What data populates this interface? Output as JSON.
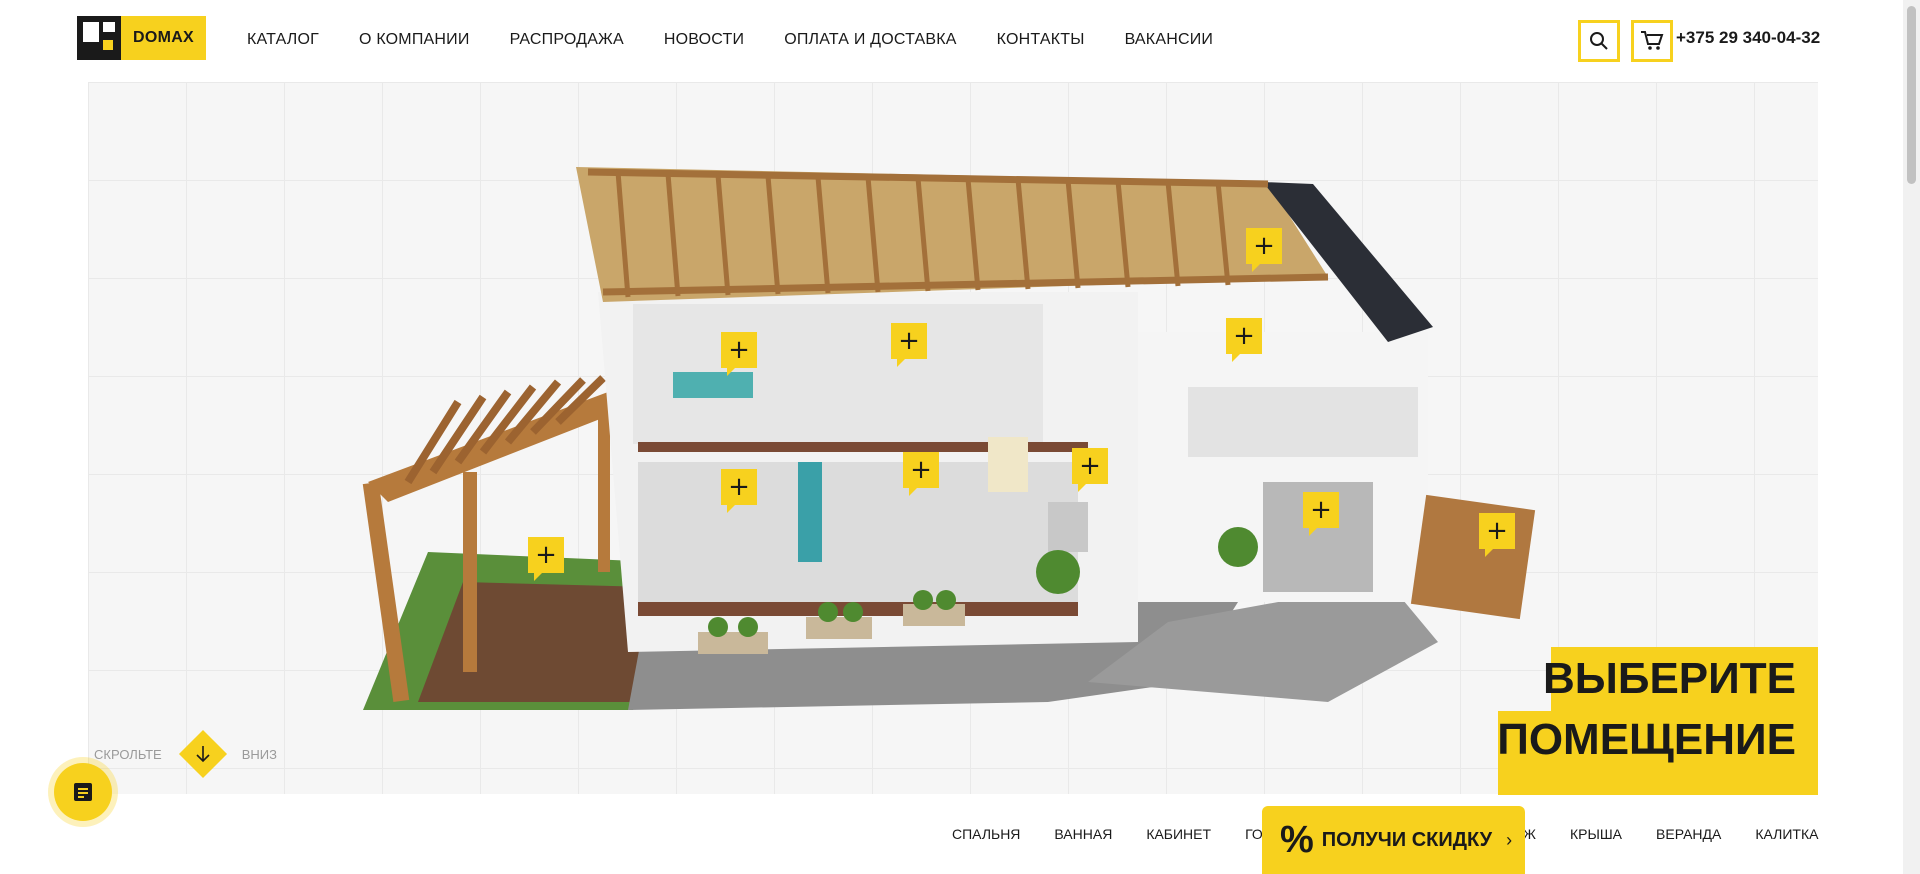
{
  "header": {
    "logo_text": "DOMAX",
    "nav": [
      "КАТАЛОГ",
      "О КОМПАНИИ",
      "РАСПРОДАЖА",
      "НОВОСТИ",
      "ОПЛАТА И ДОСТАВКА",
      "КОНТАКТЫ",
      "ВАКАНСИИ"
    ],
    "phone": "+375 29 340-04-32"
  },
  "hero": {
    "cta_line1": "ВЫБЕРИТЕ",
    "cta_line2": "ПОМЕЩЕНИЕ",
    "scroll_left": "СКРОЛЬТЕ",
    "scroll_right": "ВНИЗ"
  },
  "rooms": [
    "СПАЛЬНЯ",
    "ВАННАЯ",
    "КАБИНЕТ",
    "ГОСТИ",
    "Ж",
    "КРЫША",
    "ВЕРАНДА",
    "КАЛИТКА"
  ],
  "discount": {
    "symbol": "%",
    "label": "ПОЛУЧИ СКИДКУ",
    "chevron": "›"
  },
  "colors": {
    "accent": "#f7d11e",
    "dark": "#1a1a1a"
  }
}
